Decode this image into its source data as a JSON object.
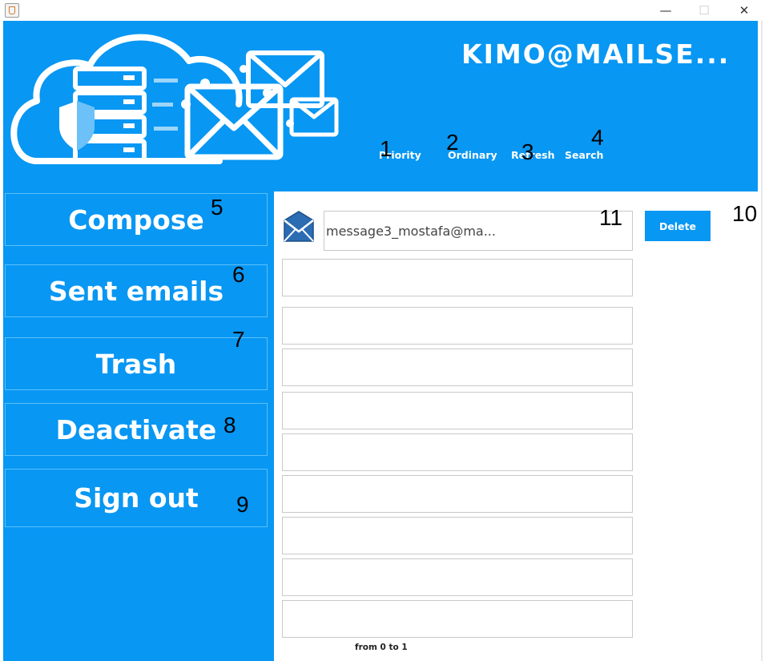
{
  "window": {
    "minimize": "—",
    "maximize": "☐",
    "close": "✕"
  },
  "header": {
    "account_title": "KIMO@MAILSE...",
    "nav": {
      "priority": "Priority",
      "ordinary": "Ordinary",
      "refresh": "Refresh",
      "search": "Search"
    }
  },
  "sidebar": {
    "compose": "Compose",
    "sent": "Sent emails",
    "trash": "Trash",
    "deactivate": "Deactivate",
    "signout": "Sign out"
  },
  "main": {
    "messages": [
      "message3_mostafa@ma...",
      "",
      "",
      "",
      "",
      "",
      "",
      "",
      "",
      ""
    ],
    "delete_label": "Delete",
    "page_info": "from 0 to 1"
  },
  "annotations": [
    "1",
    "2",
    "3",
    "4",
    "5",
    "6",
    "7",
    "8",
    "9",
    "10",
    "11"
  ],
  "colors": {
    "brand_blue": "#0897f3",
    "white": "#ffffff"
  },
  "icons": {
    "logo": "cloud-mail-security-logo",
    "message": "envelope-icon",
    "app": "java-app-icon"
  }
}
